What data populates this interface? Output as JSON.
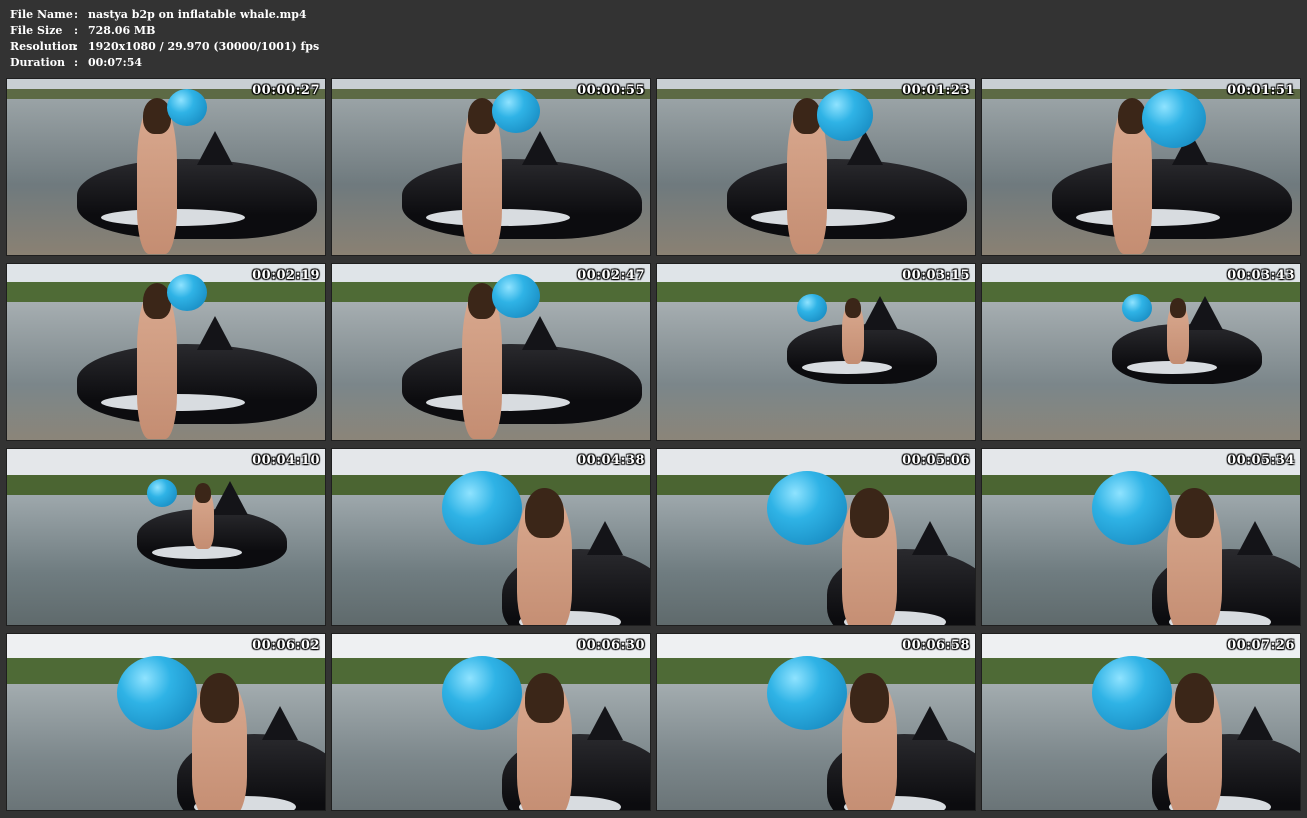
{
  "file_info": {
    "file_name_label": "File Name",
    "file_name_value": "nastya b2p on inflatable whale.mp4",
    "file_size_label": "File Size",
    "file_size_value": "728.06 MB",
    "resolution_label": "Resolution",
    "resolution_value": "1920x1080 / 29.970 (30000/1001) fps",
    "duration_label": "Duration",
    "duration_value": "00:07:54",
    "separator": ":"
  },
  "thumbnails": [
    {
      "timestamp": "00:00:27"
    },
    {
      "timestamp": "00:00:55"
    },
    {
      "timestamp": "00:01:23"
    },
    {
      "timestamp": "00:01:51"
    },
    {
      "timestamp": "00:02:19"
    },
    {
      "timestamp": "00:02:47"
    },
    {
      "timestamp": "00:03:15"
    },
    {
      "timestamp": "00:03:43"
    },
    {
      "timestamp": "00:04:10"
    },
    {
      "timestamp": "00:04:38"
    },
    {
      "timestamp": "00:05:06"
    },
    {
      "timestamp": "00:05:34"
    },
    {
      "timestamp": "00:06:02"
    },
    {
      "timestamp": "00:06:30"
    },
    {
      "timestamp": "00:06:58"
    },
    {
      "timestamp": "00:07:26"
    }
  ]
}
